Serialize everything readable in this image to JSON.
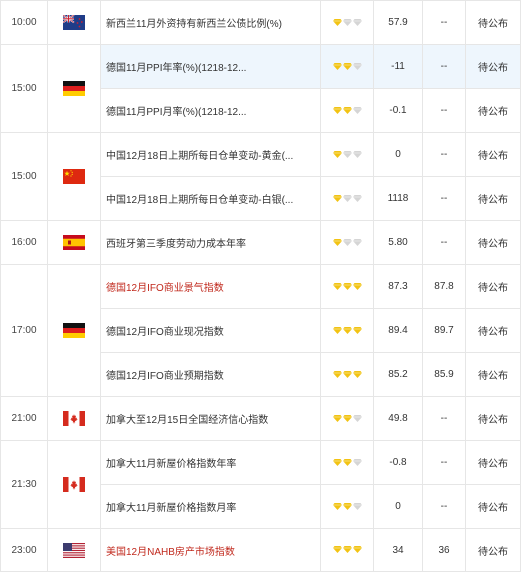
{
  "rows": [
    {
      "time": "10:00",
      "name": "新西兰11月外资持有新西兰公债比例(%)",
      "importance": 1,
      "previous": "57.9",
      "forecast": "--",
      "actual": "待公布"
    },
    {
      "time": "15:00",
      "name": "德国11月PPI年率(%)(1218-12...",
      "importance": 2,
      "previous": "-11",
      "forecast": "--",
      "actual": "待公布"
    },
    {
      "name": "德国11月PPI月率(%)(1218-12...",
      "importance": 2,
      "previous": "-0.1",
      "forecast": "--",
      "actual": "待公布"
    },
    {
      "time": "15:00",
      "name": "中国12月18日上期所每日仓单变动-黄金(...",
      "importance": 1,
      "previous": "0",
      "forecast": "--",
      "actual": "待公布"
    },
    {
      "name": "中国12月18日上期所每日仓单变动-白银(...",
      "importance": 1,
      "previous": "1118",
      "forecast": "--",
      "actual": "待公布"
    },
    {
      "time": "16:00",
      "name": "西班牙第三季度劳动力成本年率",
      "importance": 1,
      "previous": "5.80",
      "forecast": "--",
      "actual": "待公布"
    },
    {
      "time": "17:00",
      "name": "德国12月IFO商业景气指数",
      "importance": 3,
      "previous": "87.3",
      "forecast": "87.8",
      "actual": "待公布"
    },
    {
      "name": "德国12月IFO商业现况指数",
      "importance": 3,
      "previous": "89.4",
      "forecast": "89.7",
      "actual": "待公布"
    },
    {
      "name": "德国12月IFO商业预期指数",
      "importance": 3,
      "previous": "85.2",
      "forecast": "85.9",
      "actual": "待公布"
    },
    {
      "time": "21:00",
      "name": "加拿大至12月15日全国经济信心指数",
      "importance": 2,
      "previous": "49.8",
      "forecast": "--",
      "actual": "待公布"
    },
    {
      "time": "21:30",
      "name": "加拿大11月新屋价格指数年率",
      "importance": 2,
      "previous": "-0.8",
      "forecast": "--",
      "actual": "待公布"
    },
    {
      "name": "加拿大11月新屋价格指数月率",
      "importance": 2,
      "previous": "0",
      "forecast": "--",
      "actual": "待公布"
    },
    {
      "time": "23:00",
      "name": "美国12月NAHB房产市场指数",
      "importance": 3,
      "previous": "34",
      "forecast": "36",
      "actual": "待公布"
    }
  ],
  "flags": {
    "nz": "new-zealand-flag-icon",
    "de": "germany-flag-icon",
    "cn": "china-flag-icon",
    "es": "spain-flag-icon",
    "ca": "canada-flag-icon",
    "us": "usa-flag-icon"
  },
  "colors": {
    "star_on": "#f2c313",
    "star_off": "#d5d5d5",
    "important_text": "#c0281c",
    "highlight_row": "#eef6fd",
    "border": "#e6e6e6"
  }
}
